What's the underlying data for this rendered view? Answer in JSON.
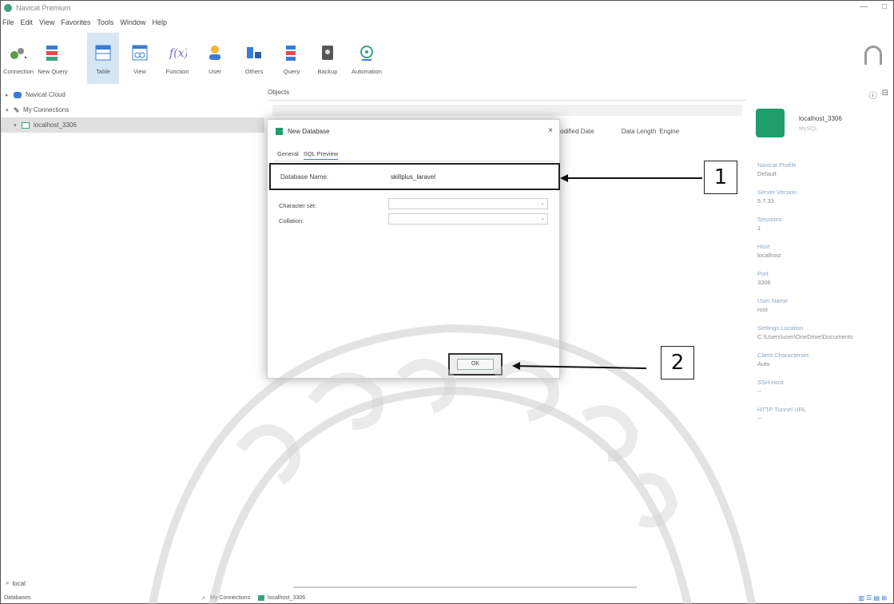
{
  "window": {
    "title": "Navicat Premium",
    "controls": [
      "—",
      "□"
    ]
  },
  "menu": [
    "File",
    "Edit",
    "View",
    "Favorites",
    "Tools",
    "Window",
    "Help"
  ],
  "toolbar": [
    {
      "label": "Connection",
      "icon": "connection-icon"
    },
    {
      "label": "New Query",
      "icon": "new-query-icon"
    },
    {
      "label": "Table",
      "icon": "table-icon"
    },
    {
      "label": "View",
      "icon": "view-icon"
    },
    {
      "label": "Function",
      "icon": "function-icon"
    },
    {
      "label": "User",
      "icon": "user-icon"
    },
    {
      "label": "Others",
      "icon": "others-icon"
    },
    {
      "label": "Query",
      "icon": "query-icon"
    },
    {
      "label": "Backup",
      "icon": "backup-icon"
    },
    {
      "label": "Automation",
      "icon": "automation-icon"
    }
  ],
  "navigator": {
    "items": [
      {
        "label": "Navicat Cloud"
      },
      {
        "label": "My Connections"
      },
      {
        "label": "localhost_3306"
      }
    ],
    "search": "local"
  },
  "objects": {
    "tab": "Objects",
    "headers": [
      "odified Date",
      "Data Length",
      "Engine"
    ]
  },
  "dialog": {
    "title": "New Database",
    "close": "×",
    "tabs": [
      "General",
      "SQL Preview"
    ],
    "database_name_label": "Database Name:",
    "database_name_value": "skillplus_laravel",
    "character_set_label": "Character set:",
    "collation_label": "Collation:",
    "ok_label": "OK"
  },
  "info_panel": {
    "name": "localhost_3306",
    "sub": "MySQL",
    "fields": [
      {
        "key": "Navicat Profile",
        "value": "Default"
      },
      {
        "key": "Server Version",
        "value": "5.7.33"
      },
      {
        "key": "Sessions",
        "value": "1"
      },
      {
        "key": "Host",
        "value": "localhost"
      },
      {
        "key": "Port",
        "value": "3306"
      },
      {
        "key": "User Name",
        "value": "root"
      },
      {
        "key": "Settings Location",
        "value": "C:\\Users\\user\\OneDrive\\Documents"
      },
      {
        "key": "Client Characterset",
        "value": "Auto"
      },
      {
        "key": "SSH Host",
        "value": "--"
      },
      {
        "key": "HTTP Tunnel URL",
        "value": "--"
      }
    ]
  },
  "statusbar": {
    "left": "Databases",
    "middle_connection": "My Connections",
    "middle_db": "localhost_3306"
  },
  "callouts": [
    "1",
    "2"
  ]
}
